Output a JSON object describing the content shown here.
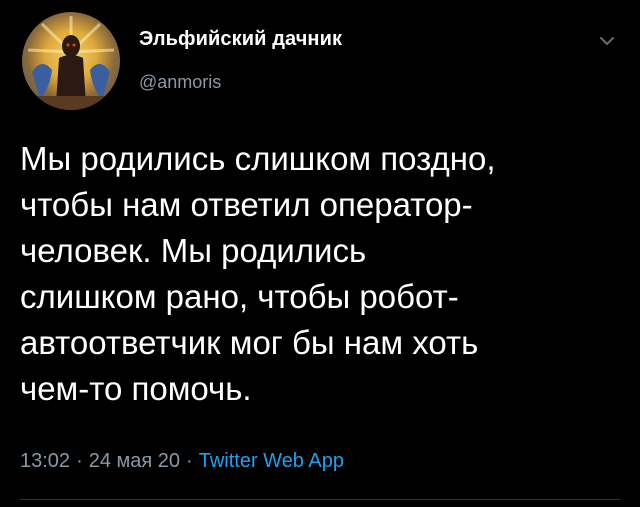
{
  "author": {
    "display_name": "Эльфийский дачник",
    "handle": "@anmoris",
    "avatar_icon": "avatar-image"
  },
  "tweet": {
    "text": "Мы родились слишком поздно,\nчтобы нам ответил оператор-\nчеловек. Мы родились\nслишком рано, чтобы робот-\nавтоответчик мог бы нам хоть\nчем-то помочь.",
    "time": "13:02",
    "separator": "·",
    "date": "24 мая 20",
    "source": "Twitter Web App"
  },
  "menu": {
    "icon": "chevron-down-icon"
  },
  "colors": {
    "background": "#000000",
    "text": "#ffffff",
    "secondary": "#8899a6",
    "link": "#1da1f2"
  }
}
